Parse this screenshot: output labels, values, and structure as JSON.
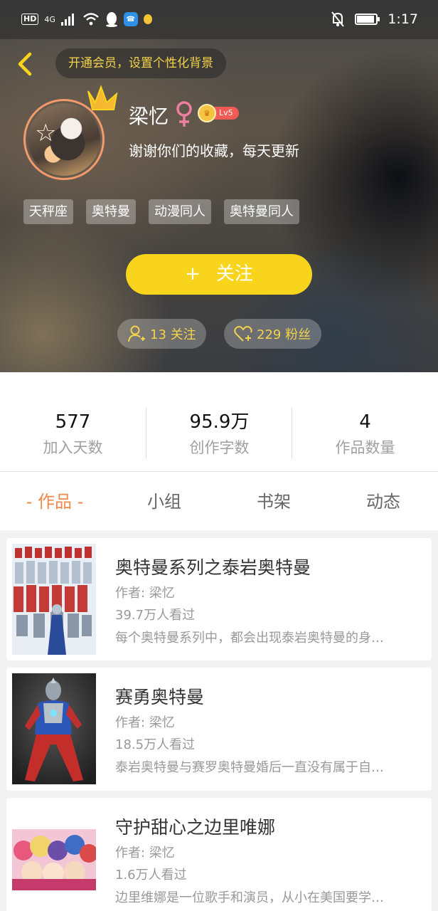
{
  "status_bar": {
    "left": {
      "hd": "HD",
      "network": "4G"
    },
    "time": "1:17"
  },
  "header": {
    "vip_prompt": "开通会员，设置个性化背景",
    "username": "梁忆",
    "level": "Lv5",
    "bio": "谢谢你们的收藏，每天更新",
    "tags": [
      "天秤座",
      "奥特曼",
      "动漫同人",
      "奥特曼同人"
    ],
    "follow_button": "关注",
    "following": "13 关注",
    "fans": "229 粉丝"
  },
  "stats": [
    {
      "value": "577",
      "label": "加入天数"
    },
    {
      "value": "95.9万",
      "label": "创作字数"
    },
    {
      "value": "4",
      "label": "作品数量"
    }
  ],
  "tabs": {
    "works": "- 作品 -",
    "groups": "小组",
    "bookshelf": "书架",
    "activity": "动态"
  },
  "works": [
    {
      "title": "奥特曼系列之泰岩奥特曼",
      "author": "作者: 梁忆",
      "views": "39.7万人看过",
      "desc": "每个奥特曼系列中，都会出现泰岩奥特曼的身…"
    },
    {
      "title": "赛勇奥特曼",
      "author": "作者: 梁忆",
      "views": "18.5万人看过",
      "desc": "泰岩奥特曼与赛罗奥特曼婚后一直没有属于自…"
    },
    {
      "title": "守护甜心之边里唯娜",
      "author": "作者: 梁忆",
      "views": "1.6万人看过",
      "desc": "边里维娜是一位歌手和演员，从小在美国要学…"
    }
  ],
  "colors": {
    "accent": "#f0894a",
    "follow": "#f8d51c",
    "gold_text": "#f4d24a",
    "level_pill": "#f15b55"
  }
}
